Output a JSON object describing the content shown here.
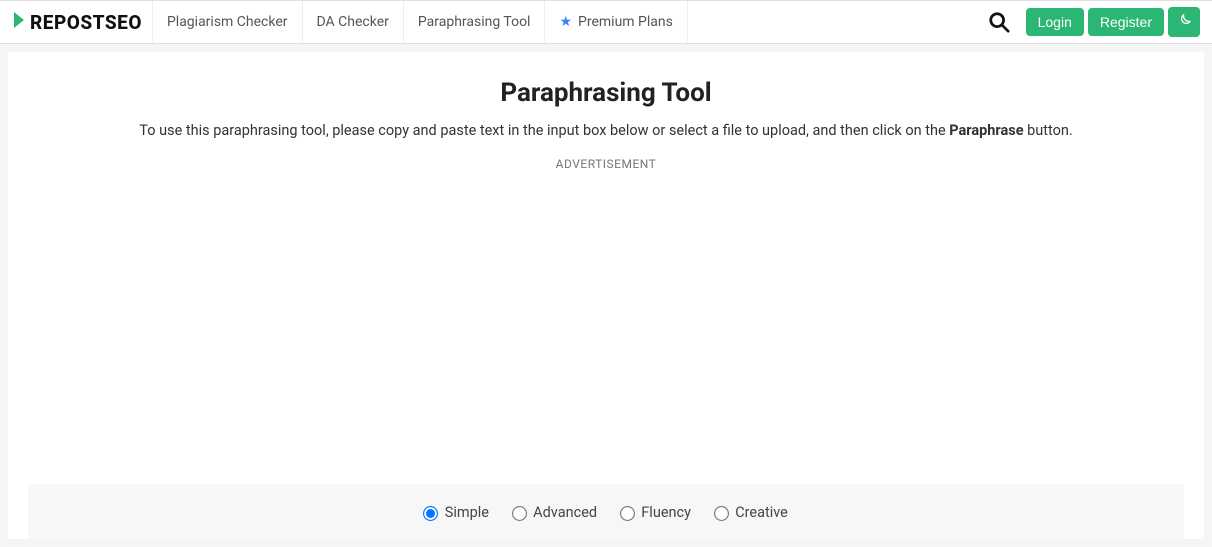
{
  "brand": {
    "name": "REPOSTSEO"
  },
  "nav": {
    "plagiarism": "Plagiarism Checker",
    "da": "DA Checker",
    "paraphrase": "Paraphrasing Tool",
    "premium": "Premium Plans"
  },
  "actions": {
    "login": "Login",
    "register": "Register"
  },
  "page": {
    "title": "Paraphrasing Tool",
    "subtitle_pre": "To use this paraphrasing tool, please copy and paste text in the input box below or select a file to upload, and then click on the ",
    "subtitle_bold": "Paraphrase",
    "subtitle_post": " button.",
    "ad_label": "ADVERTISEMENT"
  },
  "modes": {
    "simple": "Simple",
    "advanced": "Advanced",
    "fluency": "Fluency",
    "creative": "Creative"
  }
}
